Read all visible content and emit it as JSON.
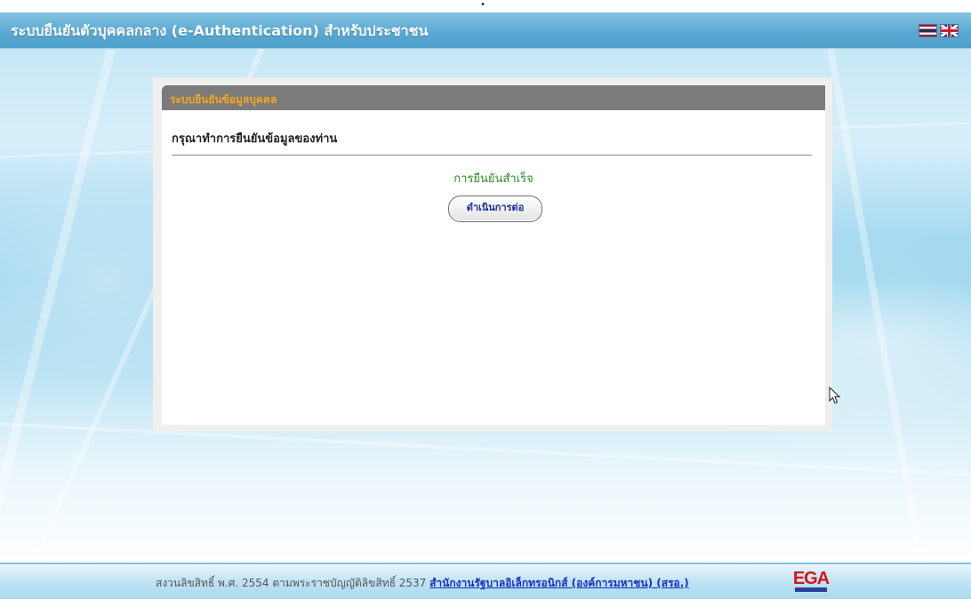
{
  "header": {
    "title": "ระบบยืนยันตัวบุคคลกลาง (e-Authentication) สำหรับประชาชน",
    "languages": [
      {
        "code": "th",
        "icon": "thai-flag-icon"
      },
      {
        "code": "en",
        "icon": "uk-flag-icon"
      }
    ]
  },
  "panel": {
    "header": "ระบบยืนยันข้อมูลบุคคล",
    "section_title": "กรุณาทำการยืนยันข้อมูลของท่าน",
    "status_message": "การยืนยันสำเร็จ",
    "continue_label": "ดำเนินการต่อ"
  },
  "footer": {
    "copyright": "สงวนลิขสิทธิ์ พ.ศ. 2554 ตามพระราชบัญญัติลิขสิทธิ์ 2537",
    "org_link": "สำนักงานรัฐบาลอิเล็กทรอนิกส์ (องค์การมหาชน) (สรอ.)",
    "logo_text": "EGA"
  },
  "colors": {
    "header_blue": "#5aa9d2",
    "panel_header_gray": "#7b7b7b",
    "panel_header_text": "#f5a623",
    "success_green": "#2a8a2a",
    "link_blue": "#1a2fbf",
    "logo_red": "#d4141c"
  }
}
